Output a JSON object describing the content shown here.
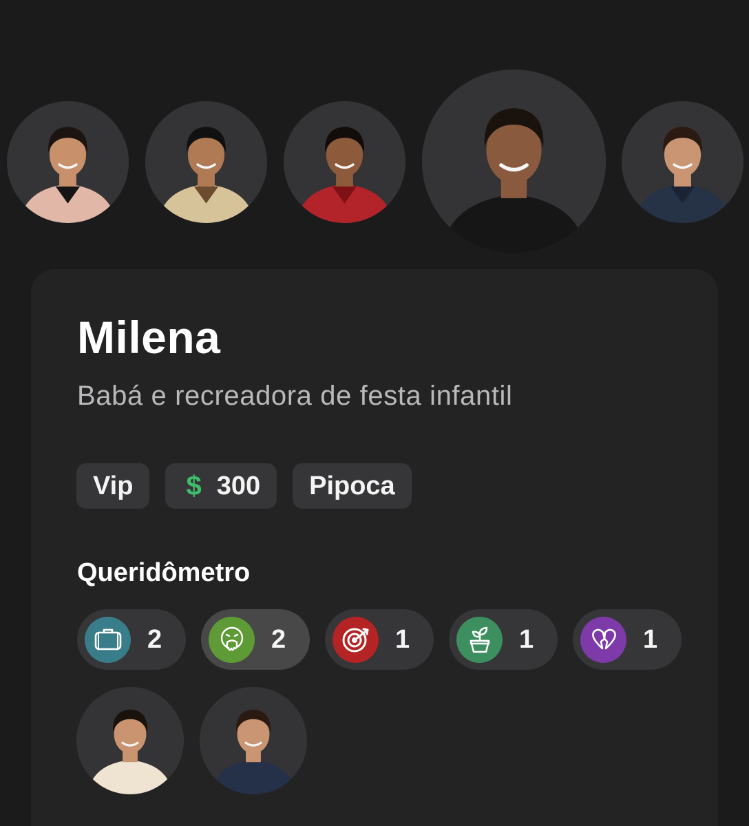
{
  "carousel": {
    "avatars": [
      {
        "id": "participant-1",
        "skin": "#c8906b",
        "hair": "#1c1410",
        "shirt": "#e1b7a8",
        "inner": "#151515"
      },
      {
        "id": "participant-2",
        "skin": "#b07a55",
        "hair": "#111111",
        "shirt": "#d7c39a",
        "inner": "#6d4b2e"
      },
      {
        "id": "participant-3",
        "skin": "#8e5a3c",
        "hair": "#120c0a",
        "shirt": "#b3232a",
        "inner": "#7e1116"
      },
      {
        "id": "participant-selected",
        "skin": "#8a5a3e",
        "hair": "#1a120d",
        "shirt": "#161616",
        "inner": "#161616"
      },
      {
        "id": "participant-5",
        "skin": "#c99573",
        "hair": "#2a1a12",
        "shirt": "#263246",
        "inner": "#1b2434"
      }
    ]
  },
  "profile": {
    "name": "Milena",
    "occupation": "Babá e recreadora de festa infantil"
  },
  "chips": {
    "group": "Vip",
    "coin_symbol": "$",
    "balance": "300",
    "category": "Pipoca"
  },
  "queridometro": {
    "title": "Queridômetro",
    "reactions": [
      {
        "icon": "suitcase-icon",
        "color": "#3a7d8a",
        "count": "2"
      },
      {
        "icon": "vomit-face-icon",
        "color": "#5e9a36",
        "count": "2"
      },
      {
        "icon": "target-icon",
        "color": "#b42424",
        "count": "1"
      },
      {
        "icon": "plant-pot-icon",
        "color": "#3d8f5f",
        "count": "1"
      },
      {
        "icon": "broken-heart-icon",
        "color": "#7d3aa8",
        "count": "1"
      }
    ],
    "givers": [
      {
        "id": "giver-1",
        "skin": "#c9946f",
        "hair": "#1a120c",
        "shirt": "#efe4d2"
      },
      {
        "id": "giver-2",
        "skin": "#c99573",
        "hair": "#2a1a12",
        "shirt": "#243149"
      }
    ]
  }
}
